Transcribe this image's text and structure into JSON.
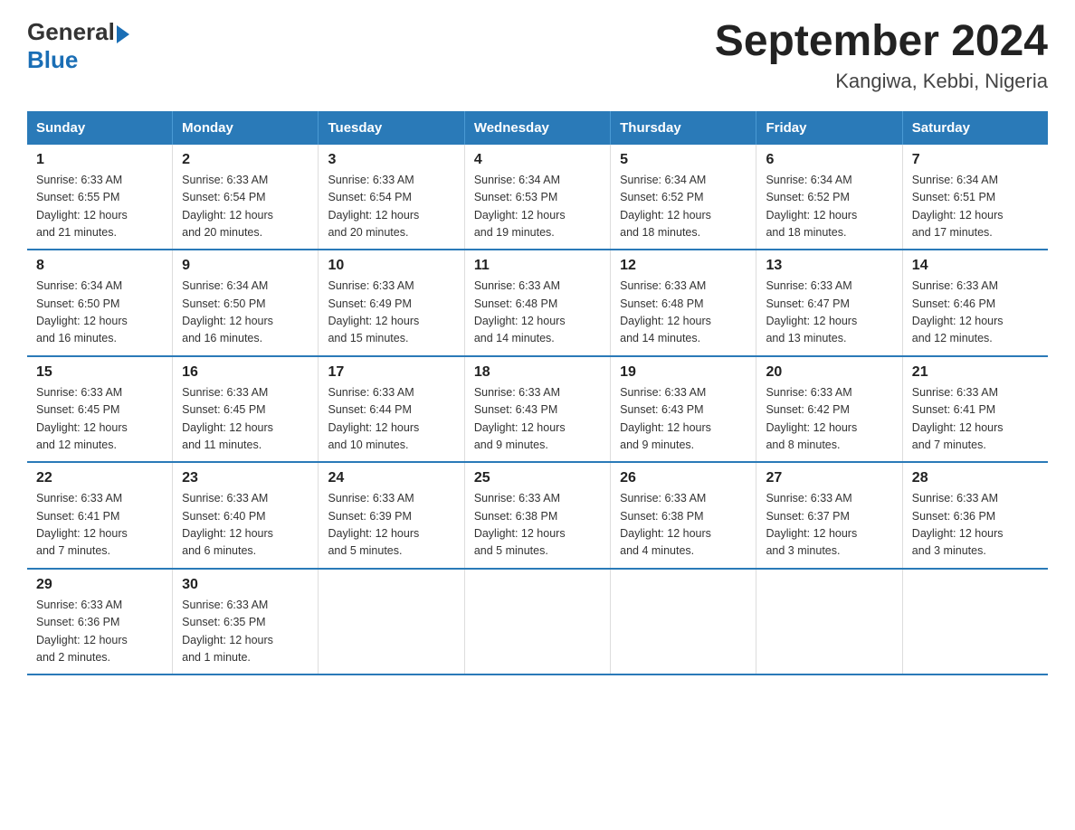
{
  "logo": {
    "general": "General",
    "blue_suffix": "Blue"
  },
  "title": "September 2024",
  "subtitle": "Kangiwa, Kebbi, Nigeria",
  "days_of_week": [
    "Sunday",
    "Monday",
    "Tuesday",
    "Wednesday",
    "Thursday",
    "Friday",
    "Saturday"
  ],
  "weeks": [
    [
      {
        "day": "1",
        "sunrise": "6:33 AM",
        "sunset": "6:55 PM",
        "daylight": "12 hours and 21 minutes."
      },
      {
        "day": "2",
        "sunrise": "6:33 AM",
        "sunset": "6:54 PM",
        "daylight": "12 hours and 20 minutes."
      },
      {
        "day": "3",
        "sunrise": "6:33 AM",
        "sunset": "6:54 PM",
        "daylight": "12 hours and 20 minutes."
      },
      {
        "day": "4",
        "sunrise": "6:34 AM",
        "sunset": "6:53 PM",
        "daylight": "12 hours and 19 minutes."
      },
      {
        "day": "5",
        "sunrise": "6:34 AM",
        "sunset": "6:52 PM",
        "daylight": "12 hours and 18 minutes."
      },
      {
        "day": "6",
        "sunrise": "6:34 AM",
        "sunset": "6:52 PM",
        "daylight": "12 hours and 18 minutes."
      },
      {
        "day": "7",
        "sunrise": "6:34 AM",
        "sunset": "6:51 PM",
        "daylight": "12 hours and 17 minutes."
      }
    ],
    [
      {
        "day": "8",
        "sunrise": "6:34 AM",
        "sunset": "6:50 PM",
        "daylight": "12 hours and 16 minutes."
      },
      {
        "day": "9",
        "sunrise": "6:34 AM",
        "sunset": "6:50 PM",
        "daylight": "12 hours and 16 minutes."
      },
      {
        "day": "10",
        "sunrise": "6:33 AM",
        "sunset": "6:49 PM",
        "daylight": "12 hours and 15 minutes."
      },
      {
        "day": "11",
        "sunrise": "6:33 AM",
        "sunset": "6:48 PM",
        "daylight": "12 hours and 14 minutes."
      },
      {
        "day": "12",
        "sunrise": "6:33 AM",
        "sunset": "6:48 PM",
        "daylight": "12 hours and 14 minutes."
      },
      {
        "day": "13",
        "sunrise": "6:33 AM",
        "sunset": "6:47 PM",
        "daylight": "12 hours and 13 minutes."
      },
      {
        "day": "14",
        "sunrise": "6:33 AM",
        "sunset": "6:46 PM",
        "daylight": "12 hours and 12 minutes."
      }
    ],
    [
      {
        "day": "15",
        "sunrise": "6:33 AM",
        "sunset": "6:45 PM",
        "daylight": "12 hours and 12 minutes."
      },
      {
        "day": "16",
        "sunrise": "6:33 AM",
        "sunset": "6:45 PM",
        "daylight": "12 hours and 11 minutes."
      },
      {
        "day": "17",
        "sunrise": "6:33 AM",
        "sunset": "6:44 PM",
        "daylight": "12 hours and 10 minutes."
      },
      {
        "day": "18",
        "sunrise": "6:33 AM",
        "sunset": "6:43 PM",
        "daylight": "12 hours and 9 minutes."
      },
      {
        "day": "19",
        "sunrise": "6:33 AM",
        "sunset": "6:43 PM",
        "daylight": "12 hours and 9 minutes."
      },
      {
        "day": "20",
        "sunrise": "6:33 AM",
        "sunset": "6:42 PM",
        "daylight": "12 hours and 8 minutes."
      },
      {
        "day": "21",
        "sunrise": "6:33 AM",
        "sunset": "6:41 PM",
        "daylight": "12 hours and 7 minutes."
      }
    ],
    [
      {
        "day": "22",
        "sunrise": "6:33 AM",
        "sunset": "6:41 PM",
        "daylight": "12 hours and 7 minutes."
      },
      {
        "day": "23",
        "sunrise": "6:33 AM",
        "sunset": "6:40 PM",
        "daylight": "12 hours and 6 minutes."
      },
      {
        "day": "24",
        "sunrise": "6:33 AM",
        "sunset": "6:39 PM",
        "daylight": "12 hours and 5 minutes."
      },
      {
        "day": "25",
        "sunrise": "6:33 AM",
        "sunset": "6:38 PM",
        "daylight": "12 hours and 5 minutes."
      },
      {
        "day": "26",
        "sunrise": "6:33 AM",
        "sunset": "6:38 PM",
        "daylight": "12 hours and 4 minutes."
      },
      {
        "day": "27",
        "sunrise": "6:33 AM",
        "sunset": "6:37 PM",
        "daylight": "12 hours and 3 minutes."
      },
      {
        "day": "28",
        "sunrise": "6:33 AM",
        "sunset": "6:36 PM",
        "daylight": "12 hours and 3 minutes."
      }
    ],
    [
      {
        "day": "29",
        "sunrise": "6:33 AM",
        "sunset": "6:36 PM",
        "daylight": "12 hours and 2 minutes."
      },
      {
        "day": "30",
        "sunrise": "6:33 AM",
        "sunset": "6:35 PM",
        "daylight": "12 hours and 1 minute."
      },
      null,
      null,
      null,
      null,
      null
    ]
  ],
  "sunrise_label": "Sunrise:",
  "sunset_label": "Sunset:",
  "daylight_label": "Daylight:"
}
